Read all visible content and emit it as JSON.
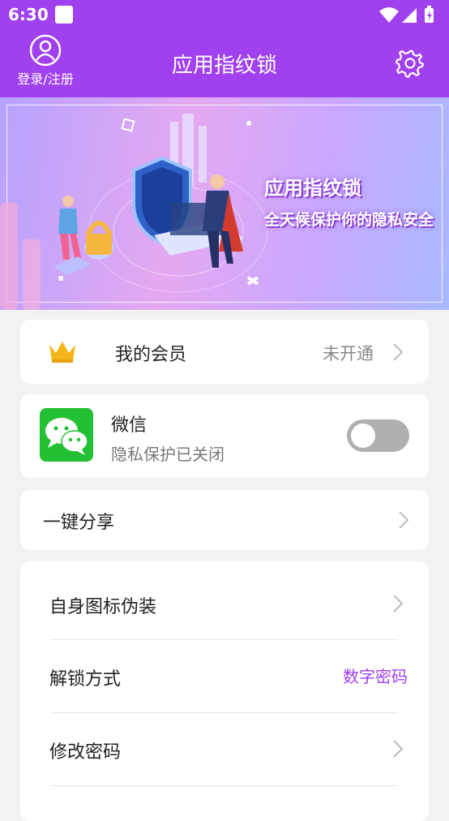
{
  "status_bar": {
    "time": "6:30"
  },
  "app_bar": {
    "login_label": "登录/注册",
    "title": "应用指纹锁"
  },
  "banner": {
    "title": "应用指纹锁",
    "subtitle": "全天候保护你的隐私安全"
  },
  "vip": {
    "label": "我的会员",
    "value": "未开通"
  },
  "wechat": {
    "name": "微信",
    "status": "隐私保护已关闭",
    "protected": false
  },
  "share": {
    "label": "一键分享"
  },
  "settings_list": {
    "icon_disguise": "自身图标伪装",
    "unlock_method": "解锁方式",
    "unlock_value": "数字密码",
    "change_password": "修改密码"
  },
  "colors": {
    "accent": "#a040ee",
    "wechat_green": "#22c032",
    "toggle_off": "#b0b0b0"
  }
}
